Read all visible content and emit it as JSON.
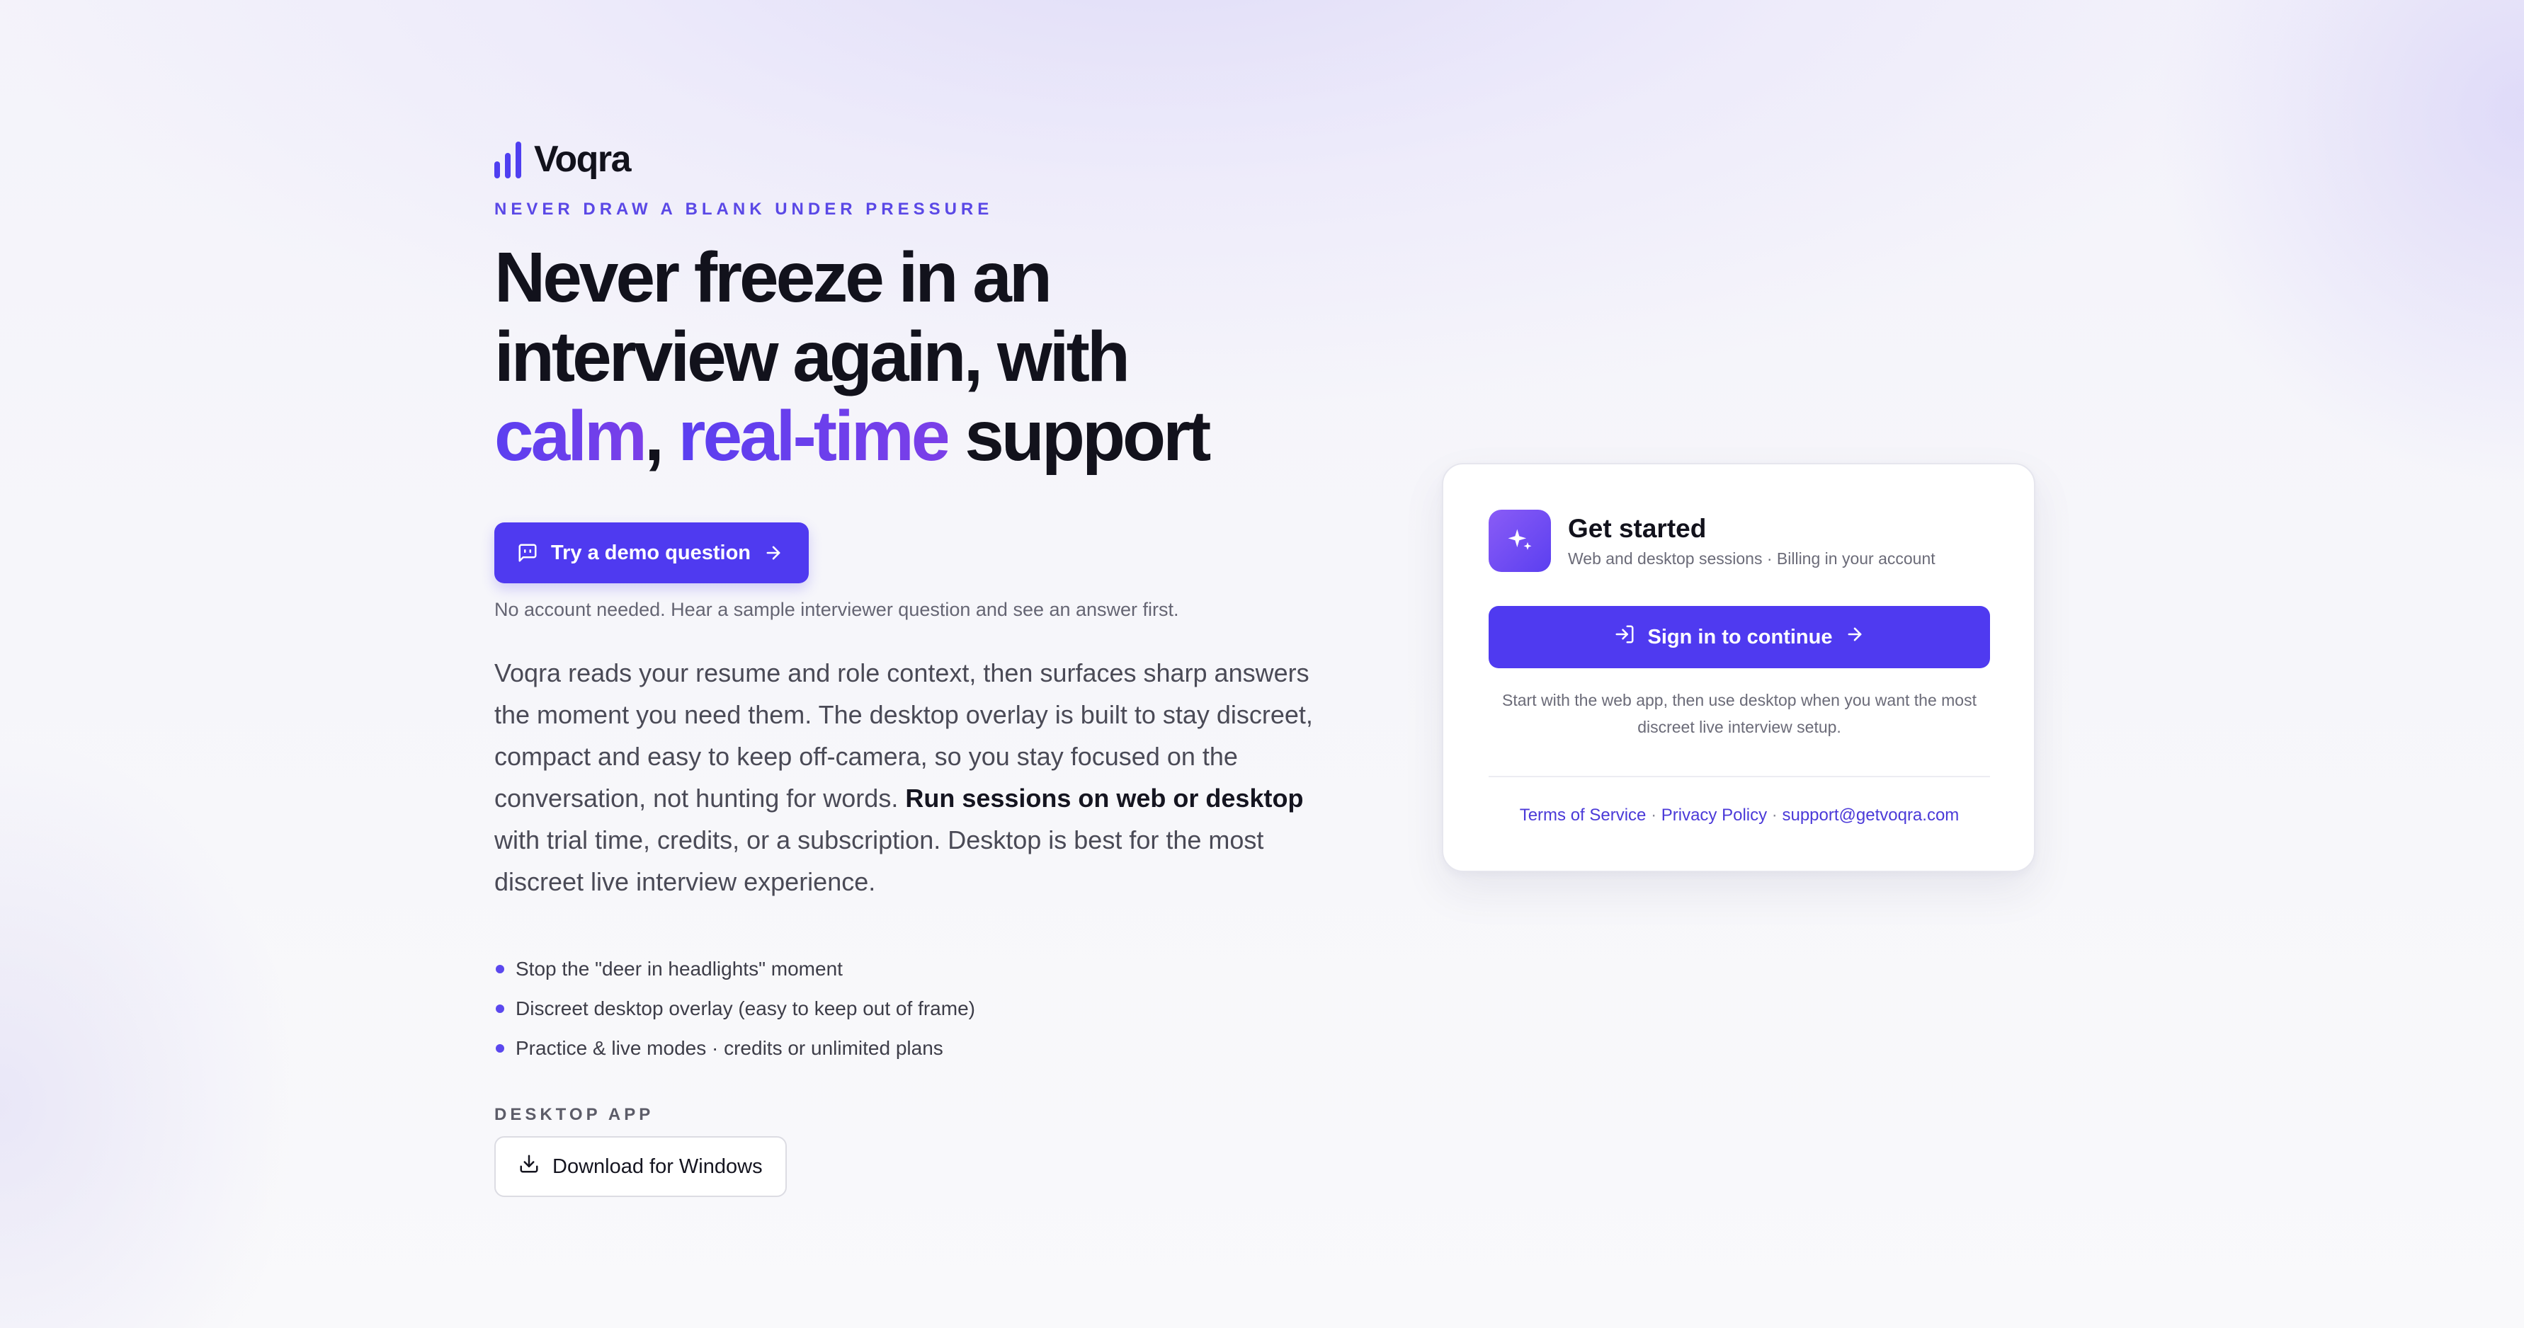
{
  "brand": {
    "name": "Voqra",
    "logo_icon": "bar-chart-icon",
    "accent": "#4f3af0"
  },
  "hero": {
    "eyebrow": "NEVER DRAW A BLANK UNDER PRESSURE",
    "headline_line1": "Never freeze in an",
    "headline_line2": "interview again, with",
    "headline_word_calm": "calm",
    "headline_comma": ",",
    "headline_word_realtime": "real-time",
    "headline_word_support": "support"
  },
  "demo": {
    "button_label": "Try a demo question",
    "button_icon": "message-square-icon",
    "note": "No account needed. Hear a sample interviewer question and see an answer first."
  },
  "description": {
    "part1": "Voqra reads your resume and role context, then surfaces sharp answers the moment you need them. The desktop overlay is built to stay discreet, compact and easy to keep off-camera, so you stay focused on the conversation, not hunting for words.",
    "emphasis": "Run sessions on web or desktop",
    "part2": "with trial time, credits, or a subscription. Desktop is best for the most discreet live interview experience."
  },
  "features": [
    {
      "text": "Stop the \"deer in headlights\" moment"
    },
    {
      "text": "Discreet desktop overlay (easy to keep out of frame)"
    },
    {
      "text": "Practice & live modes · credits or unlimited plans"
    }
  ],
  "desktop": {
    "label": "DESKTOP APP",
    "download_label": "Download for Windows",
    "download_icon": "download-icon"
  },
  "card": {
    "icon": "sparkles-icon",
    "title": "Get started",
    "subtitle": "Web and desktop sessions · Billing in your account",
    "signin_label": "Sign in to continue",
    "signin_icon": "log-in-icon",
    "note": "Start with the web app, then use desktop when you want the most discreet live interview setup.",
    "links": {
      "terms": "Terms of Service",
      "separator": "·",
      "privacy": "Privacy Policy",
      "support": "support@getvoqra.com"
    }
  }
}
